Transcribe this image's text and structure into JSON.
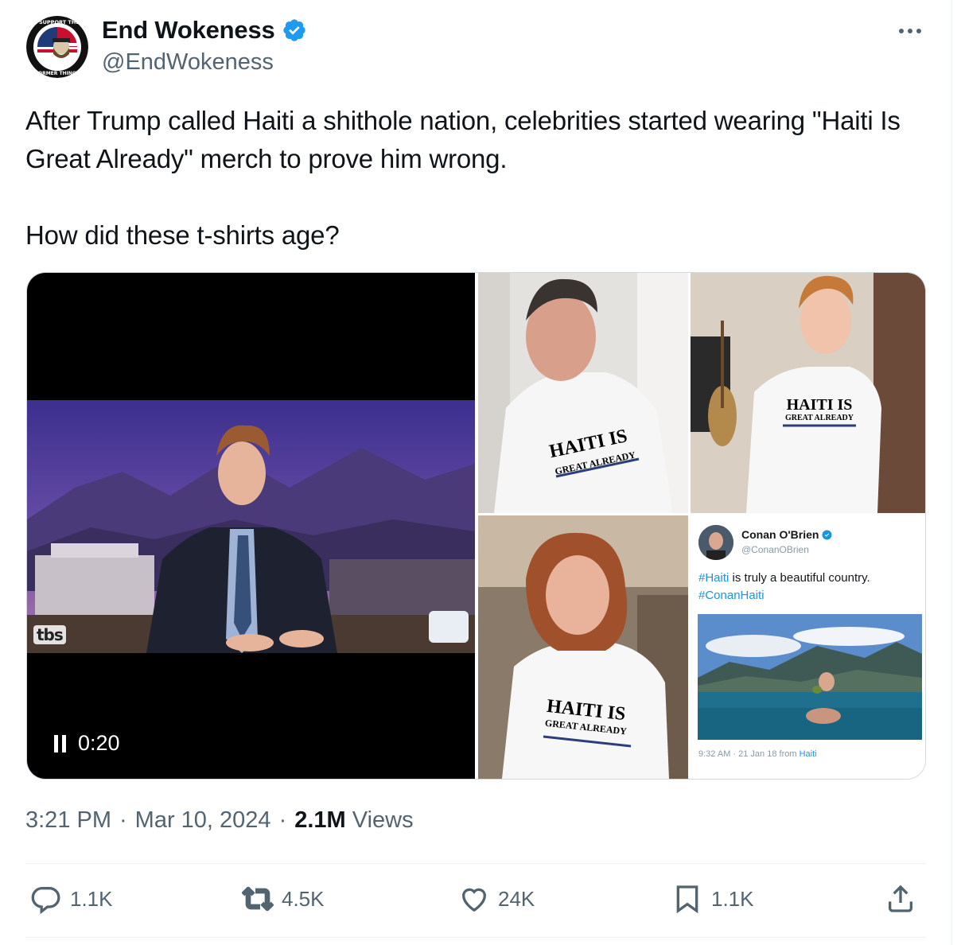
{
  "author": {
    "display_name": "End Wokeness",
    "handle": "@EndWokeness",
    "verified": true,
    "avatar_text_top": "I SUPPORT THE",
    "avatar_text_bottom": "FORMER THINGS"
  },
  "tweet": {
    "paragraph_1": "After Trump called Haiti a shithole nation, celebrities started wearing \"Haiti Is Great Already\" merch to prove him wrong.",
    "paragraph_2": "How did these t-shirts age?"
  },
  "media": {
    "video": {
      "time": "0:20",
      "channel_logo": "tbs"
    },
    "shirt_line_1": "HAITI IS",
    "shirt_line_2": "GREAT ALREADY",
    "embedded_tweet": {
      "name": "Conan O'Brien",
      "handle": "@ConanOBrien",
      "hashtag_1": "#Haiti",
      "text": " is truly a beautiful country.",
      "hashtag_2": "#ConanHaiti",
      "timestamp": "9:32 AM · 21 Jan 18 from ",
      "source": "Haiti"
    }
  },
  "meta": {
    "time": "3:21 PM",
    "date": "Mar 10, 2024",
    "views_count": "2.1M",
    "views_label": "Views",
    "separator": "·"
  },
  "actions": {
    "reply_count": "1.1K",
    "repost_count": "4.5K",
    "like_count": "24K",
    "bookmark_count": "1.1K"
  },
  "colors": {
    "verified": "#1d9bf0",
    "secondary_text": "#536471",
    "primary_text": "#0f1419",
    "border": "#cfd9de"
  }
}
